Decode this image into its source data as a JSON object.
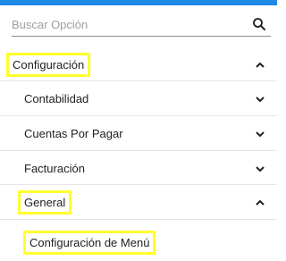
{
  "search": {
    "placeholder": "Buscar Opción",
    "icon": "search-icon"
  },
  "menu": {
    "top_item": {
      "label": "Configuración",
      "state": "expanded",
      "highlighted": true
    },
    "sub_items": [
      {
        "label": "Contabilidad",
        "state": "collapsed"
      },
      {
        "label": "Cuentas Por Pagar",
        "state": "collapsed"
      },
      {
        "label": "Facturación",
        "state": "collapsed"
      },
      {
        "label": "General",
        "state": "expanded",
        "highlighted": true
      }
    ],
    "leaf_item": {
      "label": "Configuración de Menú",
      "highlighted": true
    }
  },
  "colors": {
    "accent": "#1e88e5",
    "highlight": "#ffff2e",
    "divider": "#e6e6e6"
  }
}
